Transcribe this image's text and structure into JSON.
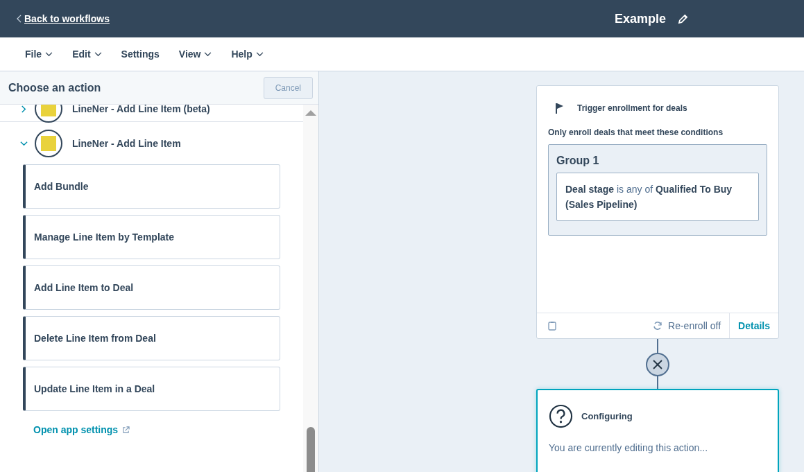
{
  "top_bar": {
    "back_link": "Back to workflows",
    "title": "Example"
  },
  "menu": [
    {
      "label": "File",
      "dropdown": true
    },
    {
      "label": "Edit",
      "dropdown": true
    },
    {
      "label": "Settings",
      "dropdown": false
    },
    {
      "label": "View",
      "dropdown": true
    },
    {
      "label": "Help",
      "dropdown": true
    }
  ],
  "panel": {
    "title": "Choose an action",
    "cancel_button": "Cancel",
    "apps": [
      {
        "name": "LineNer - Add Line Item (beta)",
        "expanded": false
      },
      {
        "name": "LineNer - Add Line Item",
        "expanded": true,
        "actions": [
          "Add Bundle",
          "Manage Line Item by Template",
          "Add Line Item to Deal",
          "Delete Line Item from Deal",
          "Update Line Item in a Deal"
        ]
      }
    ],
    "settings_link": "Open app settings"
  },
  "trigger_card": {
    "title": "Trigger enrollment for deals",
    "subtitle": "Only enroll deals that meet these conditions",
    "group": {
      "title": "Group 1",
      "condition": "**Deal stage** is any of **Qualified To Buy (Sales Pipeline)**"
    },
    "reenroll": "Re-enroll off",
    "details_link": "Details"
  },
  "config_card": {
    "title": "Configuring",
    "text": "You are currently editing this action..."
  }
}
